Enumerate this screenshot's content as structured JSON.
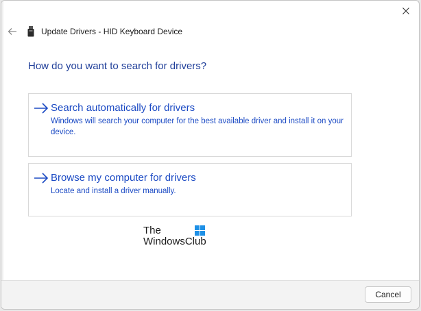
{
  "window": {
    "title": "Update Drivers - HID Keyboard Device"
  },
  "heading": "How do you want to search for drivers?",
  "options": [
    {
      "title": "Search automatically for drivers",
      "description": "Windows will search your computer for the best available driver and install it on your device."
    },
    {
      "title": "Browse my computer for drivers",
      "description": "Locate and install a driver manually."
    }
  ],
  "watermark": {
    "line1": "The",
    "line2": "WindowsClub"
  },
  "footer": {
    "cancel_label": "Cancel"
  },
  "colors": {
    "accent": "#1b4ac4",
    "heading": "#1f3e99"
  },
  "icons": {
    "close": "close-icon",
    "back": "back-arrow-icon",
    "device": "usb-device-icon",
    "option_arrow": "right-arrow-icon"
  }
}
